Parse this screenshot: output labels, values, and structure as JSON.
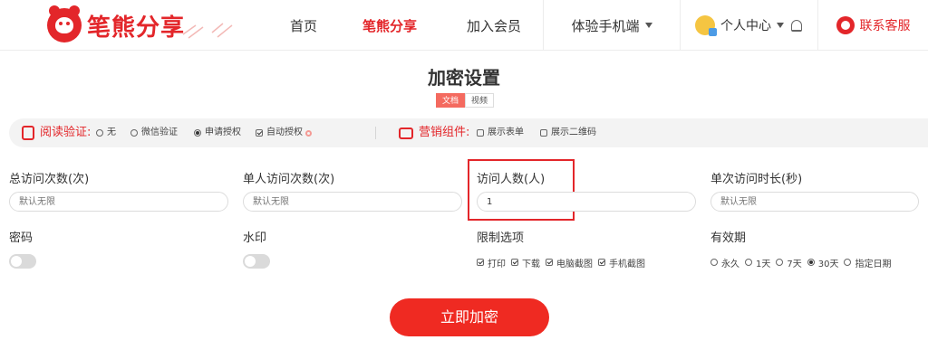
{
  "brand": {
    "name": "笔熊分享"
  },
  "nav": {
    "home": "首页",
    "share": "笔熊分享",
    "join": "加入会员",
    "mobile": "体验手机端",
    "personal": "个人中心",
    "service": "联系客服"
  },
  "page": {
    "title": "加密设置",
    "tabs": [
      "文档",
      "视频"
    ]
  },
  "options": {
    "read_label": "阅读验证:",
    "read_choices": [
      "无",
      "微信验证",
      "申请授权",
      "自动授权"
    ],
    "read_selected": "申请授权",
    "marketing_label": "营销组件:",
    "marketing_choices": [
      "展示表单",
      "展示二维码"
    ]
  },
  "form": {
    "total_visits": {
      "label": "总访问次数(次)",
      "placeholder": "默认无限"
    },
    "single_visits": {
      "label": "单人访问次数(次)",
      "placeholder": "默认无限"
    },
    "visitors": {
      "label": "访问人数(人)",
      "value": "1"
    },
    "single_duration": {
      "label": "单次访问时长(秒)",
      "placeholder": "默认无限"
    },
    "password": {
      "label": "密码",
      "enabled": false
    },
    "watermark": {
      "label": "水印",
      "enabled": false
    },
    "restrictions": {
      "label": "限制选项",
      "items": [
        "打印",
        "下载",
        "电脑截图",
        "手机截图"
      ]
    },
    "validity": {
      "label": "有效期",
      "items": [
        "永久",
        "1天",
        "7天",
        "30天",
        "指定日期"
      ],
      "selected": "30天"
    }
  },
  "submit_label": "立即加密",
  "colors": {
    "accent": "#e3262a",
    "button": "#ef2a22"
  }
}
